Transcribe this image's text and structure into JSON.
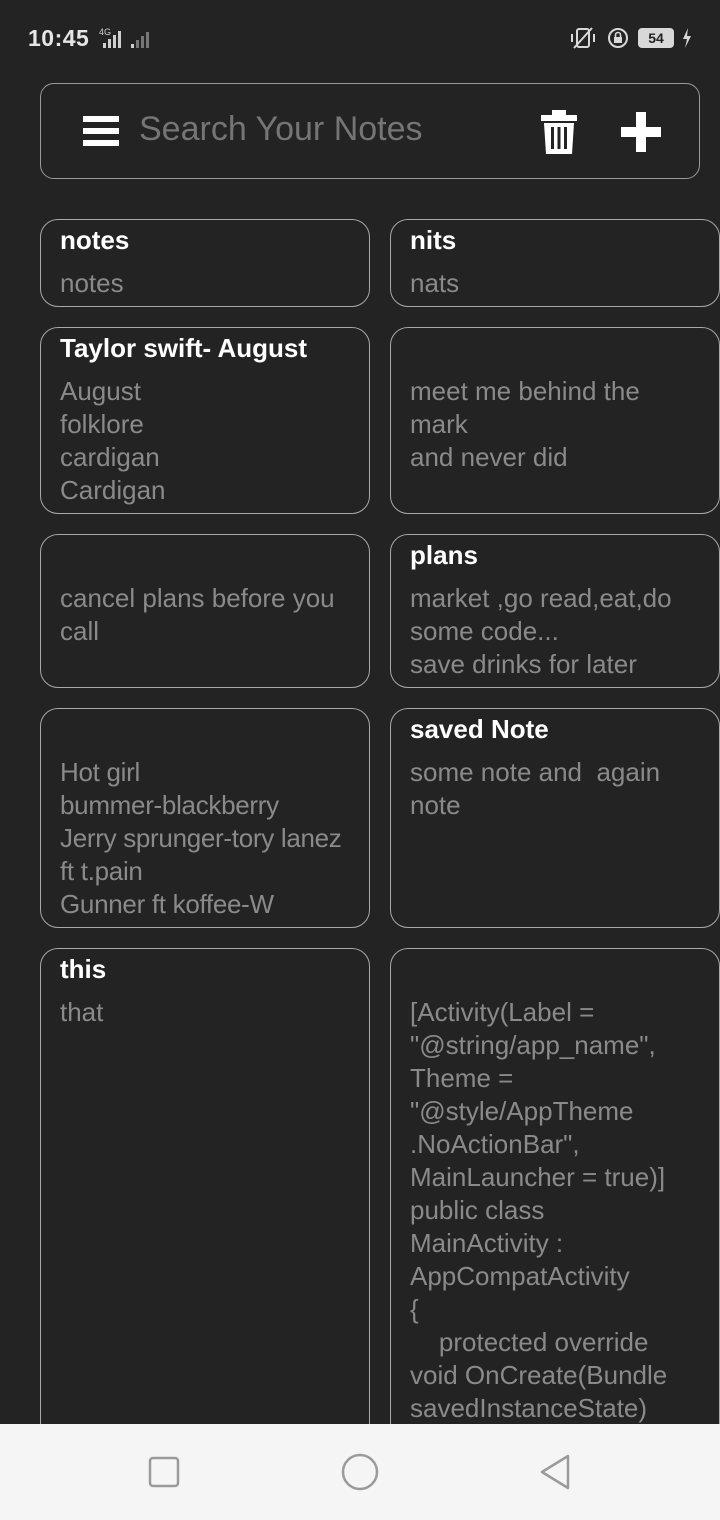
{
  "status_bar": {
    "time": "10:45",
    "network": "4G",
    "battery": "54"
  },
  "search": {
    "placeholder": "Search Your Notes"
  },
  "icons": {
    "menu": "hamburger-menu-icon",
    "delete": "trash-icon",
    "add": "plus-icon"
  },
  "notes": [
    {
      "title": "notes",
      "body": "notes"
    },
    {
      "title": "nits",
      "body": "nats"
    },
    {
      "title": "Taylor swift- August",
      "body": "August\nfolklore\ncardigan\nCardigan"
    },
    {
      "title": "",
      "body": "meet me behind the\nmark\nand never did"
    },
    {
      "title": "",
      "body": "cancel plans before you\ncall"
    },
    {
      "title": "plans",
      "body": "market ,go read,eat,do\nsome code...\nsave drinks for later"
    },
    {
      "title": "",
      "body": "Hot girl\nbummer-blackberry\nJerry sprunger-tory lanez\nft t.pain\nGunner ft koffee-W"
    },
    {
      "title": "saved Note",
      "body": "some note and  again\nnote"
    },
    {
      "title": "this",
      "body": "that"
    },
    {
      "title": "",
      "body": "[Activity(Label =\n\"@string/app_name\",\nTheme =\n\"@style/AppTheme\n.NoActionBar\",\nMainLauncher = true)]\npublic class\nMainActivity :\nAppCompatActivity\n{\n    protected override\nvoid OnCreate(Bundle\nsavedInstanceState)"
    }
  ],
  "colors": {
    "background": "#232323",
    "border": "#a8a8a8",
    "title": "#ffffff",
    "body": "#8a8a8a",
    "nav_bar": "#f5f5f5"
  }
}
